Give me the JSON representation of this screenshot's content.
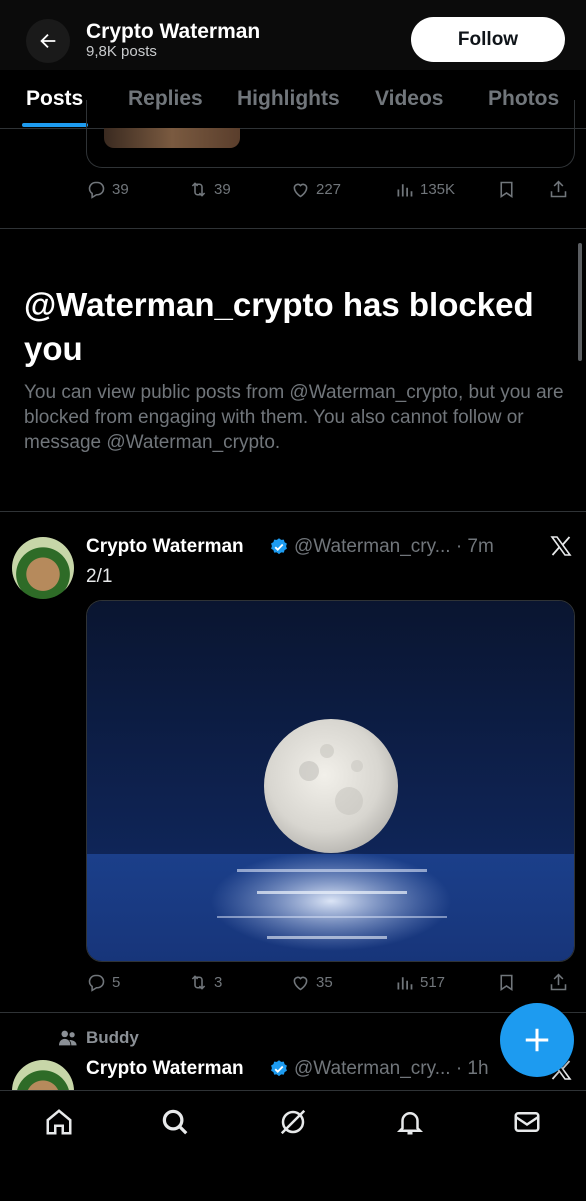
{
  "header": {
    "title": "Crypto Waterman",
    "post_count": "9,8K posts",
    "follow_label": "Follow"
  },
  "tabs": [
    {
      "label": "Posts",
      "active": true
    },
    {
      "label": "Replies",
      "active": false
    },
    {
      "label": "Highlights",
      "active": false
    },
    {
      "label": "Videos",
      "active": false
    },
    {
      "label": "Photos",
      "active": false
    }
  ],
  "prev_post": {
    "replies": "39",
    "reposts": "39",
    "likes": "227",
    "views": "135K"
  },
  "blocked": {
    "title": "@Waterman_crypto has blocked you",
    "body": "You can view public posts from @Waterman_crypto, but you are blocked from engaging with them. You also cannot follow or message @Waterman_crypto."
  },
  "post1": {
    "name": "Crypto Waterman",
    "handle_time": "@Waterman_cry... · 7m",
    "text": "2/1",
    "replies": "5",
    "reposts": "3",
    "likes": "35",
    "views": "517"
  },
  "post2": {
    "context": "Buddy",
    "name": "Crypto Waterman",
    "handle_time": "@Waterman_cry... · 1h"
  },
  "colors": {
    "accent": "#1d9bf0",
    "background": "#000000",
    "muted": "#71767b"
  },
  "nav": {
    "items": [
      "home-icon",
      "search-icon",
      "grok-icon",
      "notifications-icon",
      "messages-icon"
    ]
  }
}
